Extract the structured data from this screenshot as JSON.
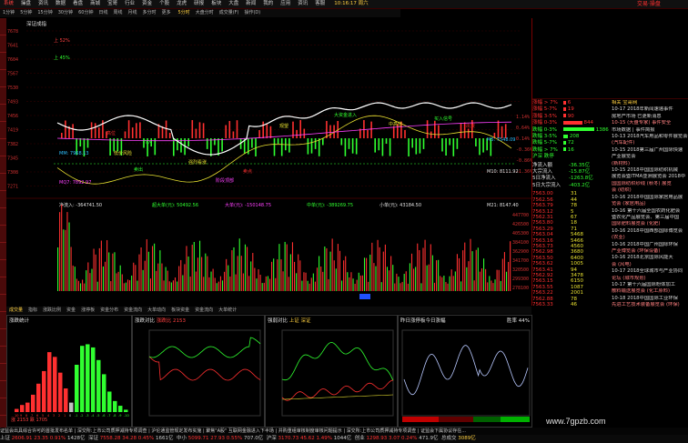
{
  "menu": [
    "系统",
    "操盘",
    "资讯",
    "数据",
    "看盘",
    "商城",
    "宝哥",
    "行业",
    "资金",
    "个股",
    "龙虎",
    "研报",
    "板块",
    "大盘",
    "新闻",
    "我的",
    "应用",
    "资讯",
    "客服"
  ],
  "time": "10:16:17 周六",
  "logo": "交易·操盘",
  "toolbar": [
    "1分钟",
    "5分钟",
    "15分钟",
    "30分钟",
    "60分钟",
    "日线",
    "周线",
    "月线",
    "多分时",
    "更多"
  ],
  "chart_tabs": [
    "5分时",
    "大盘分时",
    "成交量(F)",
    "操作(D)"
  ],
  "chart_title": "深证成指",
  "y_ticks": [
    "7678",
    "7641",
    "7604",
    "7567",
    "7530",
    "7493",
    "7456",
    "7419",
    "7382",
    "7345",
    "7308",
    "7271"
  ],
  "pct_ticks": [
    "1.14%",
    "0.64%",
    "0.14%",
    "-0.36%",
    "-0.86%",
    "-1.36%"
  ],
  "labels": {
    "l1": "上 52%",
    "l2": "上 45%",
    "ma5": "M5: 7548.09",
    "mm": "MM: 7968.13",
    "mq": "MQ7: 7892.97",
    "m10": "M10: 8111.92",
    "m21": "M21: 8147.40",
    "flow": "净流入: -364741.50",
    "big_buy": "超大单(元): 50492.56",
    "big_sell": "大单(元): -150148.75",
    "mid": "中单(元): -389269.75",
    "small": "小单(元): 43184.50"
  },
  "annotations": [
    "高位",
    "低价风险",
    "介入",
    "卖出",
    "强烈看涨",
    "阶段顶部",
    "卖点",
    "观望",
    "大资金进入",
    "中高位",
    "买入信号",
    "出货"
  ],
  "vol_ticks": [
    "447700",
    "426500",
    "405300",
    "384100",
    "362900",
    "341700",
    "320500",
    "299300",
    "278100"
  ],
  "bottom_tabs": [
    "成交量",
    "指标",
    "涨跌比例",
    "资金",
    "涨停板",
    "资金分布",
    "资金流向",
    "大单动向",
    "板块资金",
    "资金流向",
    "大单统计"
  ],
  "panels": [
    {
      "title": "涨跌统计",
      "subtitle": "涨 2153 跌 1705"
    },
    {
      "title": "涨跌对比",
      "subtitle": "涨跌比 2153"
    },
    {
      "title": "强弱对比",
      "subtitle": "上证 深证"
    },
    {
      "title": "昨日涨停板今日涨幅",
      "subtitle": "胜率 44%"
    }
  ],
  "hist": {
    "categories": [
      "10",
      "9",
      "8",
      "7",
      "6",
      "5",
      "4",
      "3",
      "2",
      "1",
      "0",
      "-1",
      "-2",
      "-3",
      "-4",
      "-5",
      "-6",
      "-7",
      "-8",
      "-9",
      "-10"
    ],
    "values": [
      20,
      45,
      60,
      110,
      180,
      260,
      380,
      350,
      250,
      150,
      60,
      300,
      420,
      430,
      410,
      330,
      240,
      130,
      70,
      40,
      15
    ]
  },
  "levels": [
    {
      "name": "涨幅 > 7%",
      "val": "6",
      "c": "#ff3030"
    },
    {
      "name": "涨幅 5-7%",
      "val": "19",
      "c": "#ff3030"
    },
    {
      "name": "涨幅 3-5%",
      "val": "90",
      "c": "#ff3030"
    },
    {
      "name": "涨幅 0-3%",
      "val": "844",
      "c": "#ff3030"
    },
    {
      "name": "跌幅 0-3%",
      "val": "1386",
      "c": "#30ff30"
    },
    {
      "name": "跌幅 3-5%",
      "val": "208",
      "c": "#30ff30"
    },
    {
      "name": "跌幅 5-7%",
      "val": "72",
      "c": "#30ff30"
    },
    {
      "name": "跌幅 > 7%",
      "val": "16",
      "c": "#30ff30"
    },
    {
      "name": "沪深 跌停",
      "val": "",
      "c": "#30ff30"
    }
  ],
  "flows": [
    {
      "name": "净流入额",
      "val": "-36.35亿"
    },
    {
      "name": "大宗流入",
      "val": "-15.87亿"
    },
    {
      "name": "5日净流入",
      "val": "-1263.8亿"
    },
    {
      "name": "5日大宗流入",
      "val": "-403.2亿"
    }
  ],
  "ticks": [
    "7563.00",
    "7562.56",
    "7563.79",
    "7563.12",
    "7562.31",
    "7563.80",
    "7563.29",
    "7563.04",
    "7563.16",
    "7563.73",
    "7562.98",
    "7563.50",
    "7563.62",
    "7563.41",
    "7562.92",
    "7563.15",
    "7563.55",
    "7563.22",
    "7562.88",
    "7563.33",
    "7563.44",
    "7563.58",
    "7563.65",
    "7563.08",
    "7563.88",
    "7563.70",
    "7562.75",
    "7563.25",
    "7563.68",
    "7558.28"
  ],
  "tick_vols": [
    "31",
    "44",
    "78",
    "5",
    "67",
    "18",
    "71",
    "5468",
    "5466",
    "4560",
    "3680",
    "6400",
    "1005",
    "94",
    "3478",
    "6150",
    "1087",
    "2001",
    "78",
    "46",
    "80",
    "40",
    "60",
    "55",
    "34",
    "68",
    "20",
    "44",
    "38",
    "58"
  ],
  "news_header": "相关 宝哥网",
  "news": [
    "10-17 2018年新闻速递事件",
    "房地产市场 已更新消息",
    "10-15 (大盘专家) 事件安全",
    "市场数据 | 事件简报",
    "10-13 2018汽车用品和零件展览会",
    "(汽车配件)",
    "10-15 2018第三届广州国际快速",
    "产业展览会",
    "(新材料)",
    "10-15 2018中国国际纺织机械",
    "展览会暨ITMA亚洲展览会 2018中",
    "国国际纺织纱线 (秋冬) 展览",
    "会 (纺织)",
    "10-16 2018中国国际家居用品展",
    "览会 (家居用品)",
    "10-16 第十六届全国农药化肥会",
    "暨农化产品展览会、第三届中国",
    "国际肥料展览会 (化肥)",
    "10-16 2018中国西部国际博览会",
    "(农业)",
    "10-16 2018中国广州国际环保",
    "产业博览会 (环保设备)",
    "10-16 2018北京国际风能大",
    "会 (风电)",
    "10-17 2018全球城市与产业协同",
    "论坛 (城市规划)",
    "10-17 第十六届国际粉体加工",
    "散料输送展览会 (化工原料)",
    "10-18 2018中国国际工业环保",
    "先进工艺技术装备展览会 (环保)"
  ],
  "ticker": "证监会出具综合许可的首批发布名单 | 深交所:上市公司质押减持专项调查 | 沪伦通监管规定发布实施 | 聚焦\"A股\" 互联网金融进入下半场 | 并购重组审核制度审核问题提示 | 深交所:上市公司质押减持专项调查 | 证监会下属协议存在...",
  "indices": [
    {
      "name": "上证",
      "val": "2606.91",
      "chg": "23.35",
      "pct": "0.91%",
      "amt": "1428亿"
    },
    {
      "name": "深证",
      "val": "7558.28",
      "chg": "34.28",
      "pct": "0.45%",
      "amt": "1661亿"
    },
    {
      "name": "中小",
      "val": "5099.71",
      "chg": "27.93",
      "pct": "0.55%",
      "amt": "707.0亿"
    },
    {
      "name": "沪深",
      "val": "3170.73",
      "chg": "45.62",
      "pct": "1.49%",
      "amt": "1044亿"
    },
    {
      "name": "创业",
      "val": "1298.93",
      "chg": "3.07",
      "pct": "0.24%",
      "amt": "471.9亿"
    },
    {
      "name": "总成交",
      "val": "3089亿",
      "chg": "",
      "pct": "",
      "amt": ""
    }
  ],
  "watermark": "www.7gpzb.com",
  "colors": {
    "red": "#ff3030",
    "green": "#30ff30",
    "yellow": "#e8e030",
    "white": "#ffffff",
    "magenta": "#ff40ff",
    "darkred": "#7a0000"
  }
}
